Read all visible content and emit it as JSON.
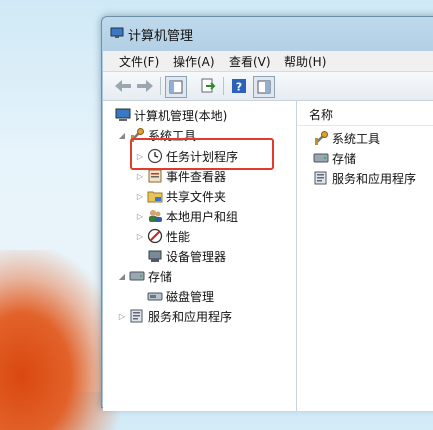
{
  "window": {
    "title": "计算机管理"
  },
  "menu": {
    "items": [
      {
        "label": "文件(F)"
      },
      {
        "label": "操作(A)"
      },
      {
        "label": "查看(V)"
      },
      {
        "label": "帮助(H)"
      }
    ]
  },
  "toolbar": {
    "buttons": [
      "back-icon",
      "forward-icon",
      "show-hide-tree-icon",
      "export-list-icon",
      "help-icon",
      "properties-icon"
    ]
  },
  "tree": {
    "root": "计算机管理(本地)",
    "system_tools": "系统工具",
    "task_scheduler": "任务计划程序",
    "event_viewer": "事件查看器",
    "shared_folders": "共享文件夹",
    "local_users": "本地用户和组",
    "performance": "性能",
    "device_manager": "设备管理器",
    "storage": "存储",
    "disk_management": "磁盘管理",
    "services_apps": "服务和应用程序"
  },
  "list": {
    "column_name": "名称",
    "items": [
      "系统工具",
      "存储",
      "服务和应用程序"
    ]
  },
  "colors": {
    "highlight": "#e23b2e",
    "accent": "#1e5fa8"
  }
}
